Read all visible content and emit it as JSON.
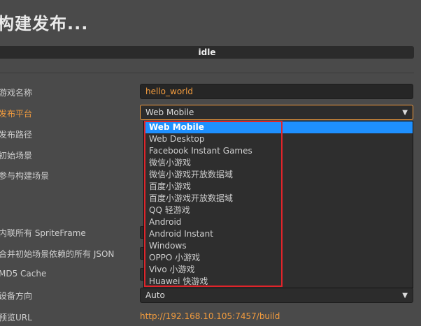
{
  "title": "构建发布...",
  "status": "idle",
  "labels": {
    "game_name": "游戏名称",
    "platform": "发布平台",
    "build_path": "发布路径",
    "start_scene": "初始场景",
    "included_scenes": "参与构建场景",
    "inline_spriteframe": "内联所有 SpriteFrame",
    "merge_json": "合并初始场景依赖的所有 JSON",
    "md5_cache": "MD5 Cache",
    "orientation": "设备方向",
    "preview_url": "预览URL"
  },
  "fields": {
    "game_name_value": "hello_world",
    "platform_value": "Web Mobile",
    "orientation_value": "Auto",
    "preview_url_value": "http://192.168.10.105:7457/build"
  },
  "platform_options": [
    "Web Mobile",
    "Web Desktop",
    "Facebook Instant Games",
    "微信小游戏",
    "微信小游戏开放数据域",
    "百度小游戏",
    "百度小游戏开放数据域",
    "QQ 轻游戏",
    "Android",
    "Android Instant",
    "Windows",
    "OPPO 小游戏",
    "Vivo 小游戏",
    "Huawei 快游戏"
  ],
  "selected_option_index": 0,
  "colors": {
    "background": "#4a4a4a",
    "accent": "#f39c3e",
    "selection": "#1e90ff",
    "highlight_box": "#e0242a"
  },
  "icons": {
    "dropdown_caret": "▼"
  }
}
